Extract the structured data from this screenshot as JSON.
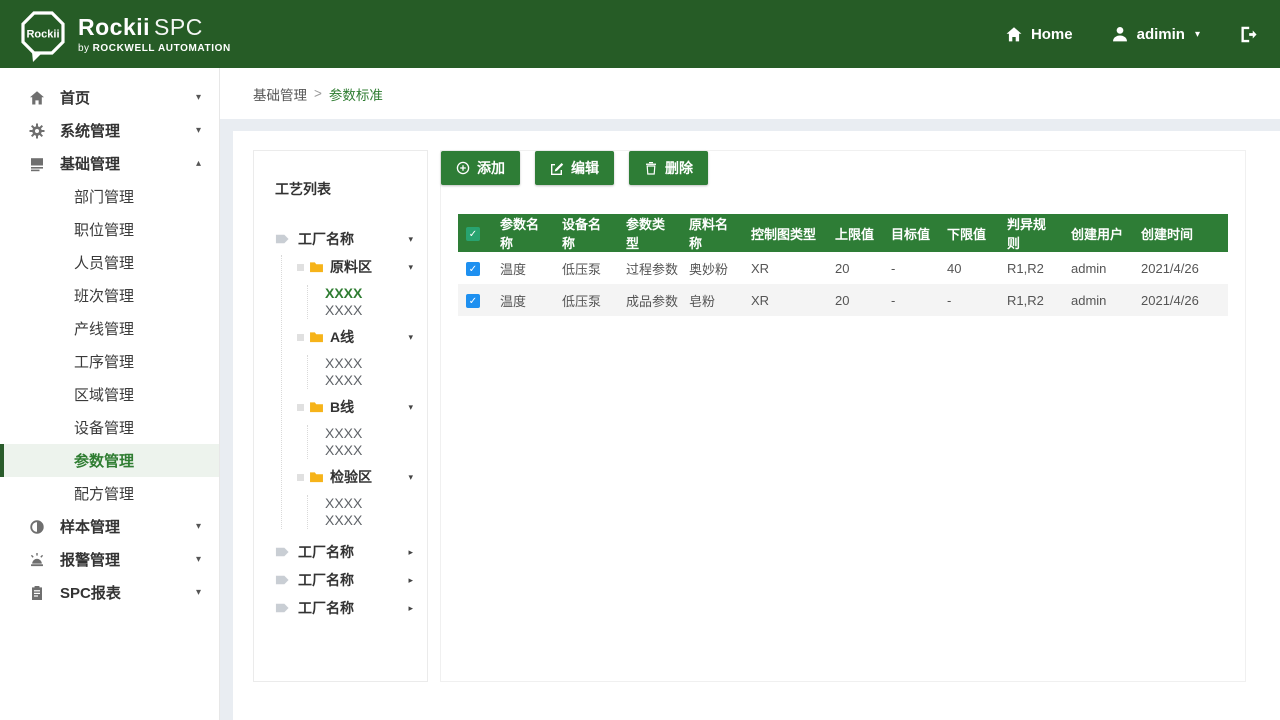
{
  "header": {
    "logo_text": "Rockii",
    "brand": "Rockii",
    "brand_suffix": "SPC",
    "byline_by": "by",
    "byline_company": "ROCKWELL AUTOMATION",
    "home_label": "Home",
    "user_name": "adimin"
  },
  "sidebar": {
    "items": [
      {
        "label": "首页",
        "icon": "home-icon"
      },
      {
        "label": "系统管理",
        "icon": "gear-icon"
      },
      {
        "label": "基础管理",
        "icon": "modules-icon",
        "expanded": true,
        "children": [
          "部门管理",
          "职位管理",
          "人员管理",
          "班次管理",
          "产线管理",
          "工序管理",
          "区域管理",
          "设备管理",
          "参数管理",
          "配方管理"
        ],
        "active_child": "参数管理"
      },
      {
        "label": "样本管理",
        "icon": "sample-icon"
      },
      {
        "label": "报警管理",
        "icon": "alarm-icon"
      },
      {
        "label": "SPC报表",
        "icon": "report-icon"
      }
    ]
  },
  "breadcrumb": {
    "parent": "基础管理",
    "separator": ">",
    "current": "参数标准"
  },
  "tree": {
    "title": "工艺列表",
    "factory_nodes": [
      {
        "label": "工厂名称",
        "expanded": true,
        "areas": [
          {
            "label": "原料区",
            "items": [
              "XXXX",
              "XXXX"
            ],
            "selected_item_index": 0
          },
          {
            "label": "A线",
            "items": [
              "XXXX",
              "XXXX"
            ]
          },
          {
            "label": "B线",
            "items": [
              "XXXX",
              "XXXX"
            ]
          },
          {
            "label": "检验区",
            "items": [
              "XXXX",
              "XXXX"
            ]
          }
        ]
      },
      {
        "label": "工厂名称",
        "expanded": false
      },
      {
        "label": "工厂名称",
        "expanded": false
      },
      {
        "label": "工厂名称",
        "expanded": false
      }
    ]
  },
  "toolbar": {
    "add_label": "添加",
    "edit_label": "编辑",
    "delete_label": "删除"
  },
  "table": {
    "header_checked": true,
    "columns": [
      "参数名称",
      "设备名称",
      "参数类型",
      "原料名称",
      "控制图类型",
      "上限值",
      "目标值",
      "下限值",
      "判异规则",
      "创建用户",
      "创建时间"
    ],
    "rows": [
      [
        "温度",
        "低压泵",
        "过程参数",
        "奥妙粉",
        "XR",
        "20",
        "-",
        "40",
        "R1,R2",
        "admin",
        "2021/4/26"
      ],
      [
        "温度",
        "低压泵",
        "成品参数",
        "皂粉",
        "XR",
        "20",
        "-",
        "-",
        "R1,R2",
        "admin",
        "2021/4/26"
      ]
    ],
    "rows_checked": [
      true,
      true
    ]
  },
  "colors": {
    "header_green": "#265c26",
    "accent_green": "#2e7d36",
    "active_text_green": "#2f7d32",
    "folder_yellow": "#f6b319",
    "row_checkbox_blue": "#1e90f0",
    "header_checkbox_teal": "#28a370",
    "content_bg": "#e9edf2"
  }
}
